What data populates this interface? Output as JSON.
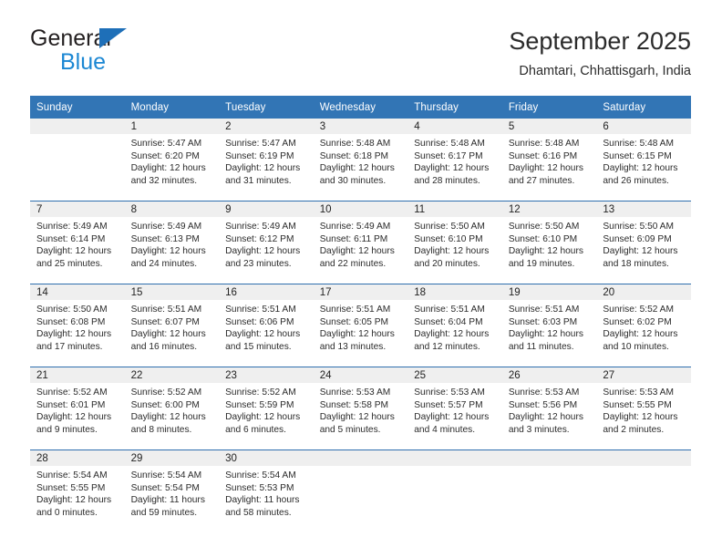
{
  "brand": {
    "name_top": "General",
    "name_bottom": "Blue",
    "triangle_color": "#1e6fb8",
    "blue_color": "#1b87d3"
  },
  "header": {
    "title": "September 2025",
    "subtitle": "Dhamtari, Chhattisgarh, India"
  },
  "theme": {
    "header_background": "#3275b5",
    "header_text": "#ffffff",
    "daynum_background": "#efefef",
    "row_separator": "#2f6fae"
  },
  "calendar": {
    "weekday_headers": [
      "Sunday",
      "Monday",
      "Tuesday",
      "Wednesday",
      "Thursday",
      "Friday",
      "Saturday"
    ],
    "weeks": [
      [
        {
          "day": "",
          "lines": []
        },
        {
          "day": "1",
          "lines": [
            "Sunrise: 5:47 AM",
            "Sunset: 6:20 PM",
            "Daylight: 12 hours",
            "and 32 minutes."
          ]
        },
        {
          "day": "2",
          "lines": [
            "Sunrise: 5:47 AM",
            "Sunset: 6:19 PM",
            "Daylight: 12 hours",
            "and 31 minutes."
          ]
        },
        {
          "day": "3",
          "lines": [
            "Sunrise: 5:48 AM",
            "Sunset: 6:18 PM",
            "Daylight: 12 hours",
            "and 30 minutes."
          ]
        },
        {
          "day": "4",
          "lines": [
            "Sunrise: 5:48 AM",
            "Sunset: 6:17 PM",
            "Daylight: 12 hours",
            "and 28 minutes."
          ]
        },
        {
          "day": "5",
          "lines": [
            "Sunrise: 5:48 AM",
            "Sunset: 6:16 PM",
            "Daylight: 12 hours",
            "and 27 minutes."
          ]
        },
        {
          "day": "6",
          "lines": [
            "Sunrise: 5:48 AM",
            "Sunset: 6:15 PM",
            "Daylight: 12 hours",
            "and 26 minutes."
          ]
        }
      ],
      [
        {
          "day": "7",
          "lines": [
            "Sunrise: 5:49 AM",
            "Sunset: 6:14 PM",
            "Daylight: 12 hours",
            "and 25 minutes."
          ]
        },
        {
          "day": "8",
          "lines": [
            "Sunrise: 5:49 AM",
            "Sunset: 6:13 PM",
            "Daylight: 12 hours",
            "and 24 minutes."
          ]
        },
        {
          "day": "9",
          "lines": [
            "Sunrise: 5:49 AM",
            "Sunset: 6:12 PM",
            "Daylight: 12 hours",
            "and 23 minutes."
          ]
        },
        {
          "day": "10",
          "lines": [
            "Sunrise: 5:49 AM",
            "Sunset: 6:11 PM",
            "Daylight: 12 hours",
            "and 22 minutes."
          ]
        },
        {
          "day": "11",
          "lines": [
            "Sunrise: 5:50 AM",
            "Sunset: 6:10 PM",
            "Daylight: 12 hours",
            "and 20 minutes."
          ]
        },
        {
          "day": "12",
          "lines": [
            "Sunrise: 5:50 AM",
            "Sunset: 6:10 PM",
            "Daylight: 12 hours",
            "and 19 minutes."
          ]
        },
        {
          "day": "13",
          "lines": [
            "Sunrise: 5:50 AM",
            "Sunset: 6:09 PM",
            "Daylight: 12 hours",
            "and 18 minutes."
          ]
        }
      ],
      [
        {
          "day": "14",
          "lines": [
            "Sunrise: 5:50 AM",
            "Sunset: 6:08 PM",
            "Daylight: 12 hours",
            "and 17 minutes."
          ]
        },
        {
          "day": "15",
          "lines": [
            "Sunrise: 5:51 AM",
            "Sunset: 6:07 PM",
            "Daylight: 12 hours",
            "and 16 minutes."
          ]
        },
        {
          "day": "16",
          "lines": [
            "Sunrise: 5:51 AM",
            "Sunset: 6:06 PM",
            "Daylight: 12 hours",
            "and 15 minutes."
          ]
        },
        {
          "day": "17",
          "lines": [
            "Sunrise: 5:51 AM",
            "Sunset: 6:05 PM",
            "Daylight: 12 hours",
            "and 13 minutes."
          ]
        },
        {
          "day": "18",
          "lines": [
            "Sunrise: 5:51 AM",
            "Sunset: 6:04 PM",
            "Daylight: 12 hours",
            "and 12 minutes."
          ]
        },
        {
          "day": "19",
          "lines": [
            "Sunrise: 5:51 AM",
            "Sunset: 6:03 PM",
            "Daylight: 12 hours",
            "and 11 minutes."
          ]
        },
        {
          "day": "20",
          "lines": [
            "Sunrise: 5:52 AM",
            "Sunset: 6:02 PM",
            "Daylight: 12 hours",
            "and 10 minutes."
          ]
        }
      ],
      [
        {
          "day": "21",
          "lines": [
            "Sunrise: 5:52 AM",
            "Sunset: 6:01 PM",
            "Daylight: 12 hours",
            "and 9 minutes."
          ]
        },
        {
          "day": "22",
          "lines": [
            "Sunrise: 5:52 AM",
            "Sunset: 6:00 PM",
            "Daylight: 12 hours",
            "and 8 minutes."
          ]
        },
        {
          "day": "23",
          "lines": [
            "Sunrise: 5:52 AM",
            "Sunset: 5:59 PM",
            "Daylight: 12 hours",
            "and 6 minutes."
          ]
        },
        {
          "day": "24",
          "lines": [
            "Sunrise: 5:53 AM",
            "Sunset: 5:58 PM",
            "Daylight: 12 hours",
            "and 5 minutes."
          ]
        },
        {
          "day": "25",
          "lines": [
            "Sunrise: 5:53 AM",
            "Sunset: 5:57 PM",
            "Daylight: 12 hours",
            "and 4 minutes."
          ]
        },
        {
          "day": "26",
          "lines": [
            "Sunrise: 5:53 AM",
            "Sunset: 5:56 PM",
            "Daylight: 12 hours",
            "and 3 minutes."
          ]
        },
        {
          "day": "27",
          "lines": [
            "Sunrise: 5:53 AM",
            "Sunset: 5:55 PM",
            "Daylight: 12 hours",
            "and 2 minutes."
          ]
        }
      ],
      [
        {
          "day": "28",
          "lines": [
            "Sunrise: 5:54 AM",
            "Sunset: 5:55 PM",
            "Daylight: 12 hours",
            "and 0 minutes."
          ]
        },
        {
          "day": "29",
          "lines": [
            "Sunrise: 5:54 AM",
            "Sunset: 5:54 PM",
            "Daylight: 11 hours",
            "and 59 minutes."
          ]
        },
        {
          "day": "30",
          "lines": [
            "Sunrise: 5:54 AM",
            "Sunset: 5:53 PM",
            "Daylight: 11 hours",
            "and 58 minutes."
          ]
        },
        {
          "day": "",
          "lines": []
        },
        {
          "day": "",
          "lines": []
        },
        {
          "day": "",
          "lines": []
        },
        {
          "day": "",
          "lines": []
        }
      ]
    ]
  }
}
